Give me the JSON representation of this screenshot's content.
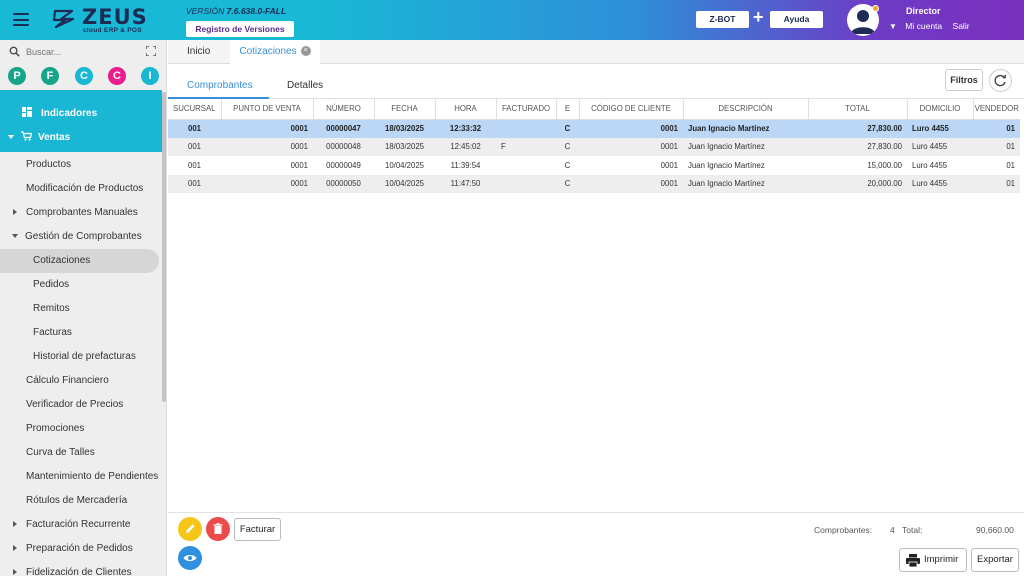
{
  "header": {
    "brand": "ZEUS",
    "brand_sub": "cloud ERP & POS",
    "version_label": "VERSIÓN",
    "version_value": "7.6.638.0-FALL",
    "registro_label": "Registro de Versiones",
    "zbot_label": "Z-BOT",
    "plus": "+",
    "ayuda_label": "Ayuda",
    "user_role": "Director",
    "mi_cuenta": "Mi cuenta",
    "salir": "Salir",
    "colors": {
      "accent": "#19b7d4",
      "purple": "#7b2fbe",
      "navy": "#1d2b55"
    }
  },
  "sidebar": {
    "search_placeholder": "Buscar...",
    "favorites": [
      {
        "letter": "P",
        "color": "#17a589"
      },
      {
        "letter": "F",
        "color": "#17a589"
      },
      {
        "letter": "C",
        "color": "#19b7d4"
      },
      {
        "letter": "C",
        "color": "#e91e8c"
      },
      {
        "letter": "I",
        "color": "#19b7d4"
      }
    ],
    "items": [
      "Indicadores",
      "Ventas",
      "Productos",
      "Modificación de Productos",
      "Comprobantes Manuales",
      "Gestión de Comprobantes",
      "Cotizaciones",
      "Pedidos",
      "Remitos",
      "Facturas",
      "Historial de prefacturas",
      "Cálculo Financiero",
      "Verificador de Precios",
      "Promociones",
      "Curva de Talles",
      "Mantenimiento de Pendientes",
      "Rótulos de Mercadería",
      "Facturación Recurrente",
      "Preparación de Pedidos",
      "Fidelización de Clientes"
    ]
  },
  "tabs": {
    "inicio": "Inicio",
    "cotizaciones": "Cotizaciones",
    "close": "×"
  },
  "subtabs": {
    "comprobantes": "Comprobantes",
    "detalles": "Detalles"
  },
  "toolbar": {
    "filtros": "Filtros"
  },
  "table": {
    "columns": [
      "SUCURSAL",
      "PUNTO DE VENTA",
      "NÚMERO",
      "FECHA",
      "HORA",
      "FACTURADO",
      "E",
      "CÓDIGO DE CLIENTE",
      "DESCRIPCIÓN",
      "TOTAL",
      "DOMICILIO",
      "VENDEDOR"
    ],
    "rows": [
      [
        "001",
        "0001",
        "00000047",
        "18/03/2025",
        "12:33:32",
        "",
        "C",
        "0001",
        "Juan Ignacio Martínez",
        "27,830.00",
        "Luro 4455",
        "01"
      ],
      [
        "001",
        "0001",
        "00000048",
        "18/03/2025",
        "12:45:02",
        "F",
        "C",
        "0001",
        "Juan Ignacio Martínez",
        "27,830.00",
        "Luro 4455",
        "01"
      ],
      [
        "001",
        "0001",
        "00000049",
        "10/04/2025",
        "11:39:54",
        "",
        "C",
        "0001",
        "Juan Ignacio Martínez",
        "15,000.00",
        "Luro 4455",
        "01"
      ],
      [
        "001",
        "0001",
        "00000050",
        "10/04/2025",
        "11:47:50",
        "",
        "C",
        "0001",
        "Juan Ignacio Martínez",
        "20,000.00",
        "Luro 4455",
        "01"
      ]
    ]
  },
  "footer": {
    "facturar": "Facturar",
    "comprobantes_label": "Comprobantes:",
    "comprobantes_count": "4",
    "total_label": "Total:",
    "total_value": "90,660.00",
    "imprimir": "Imprimir",
    "exportar": "Exportar"
  }
}
